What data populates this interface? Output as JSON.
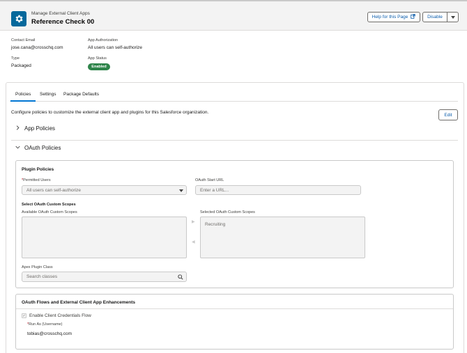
{
  "header": {
    "breadcrumb": "Manage External Client Apps",
    "title": "Reference Check 00",
    "help_label": "Help for this Page",
    "disable_label": "Disable"
  },
  "details": {
    "contact_email_label": "Contact Email",
    "contact_email_value": "jose.cana@crosschq.com",
    "app_authorization_label": "App Authorization",
    "app_authorization_value": "All users can self-authorize",
    "type_label": "Type",
    "type_value": "Packaged",
    "app_status_label": "App Status",
    "app_status_value": "Enabled"
  },
  "tabs": [
    {
      "label": "Policies",
      "active": true
    },
    {
      "label": "Settings",
      "active": false
    },
    {
      "label": "Package Defaults",
      "active": false
    }
  ],
  "policies": {
    "description": "Configure policies to customize the external client app and plugins for this Salesforce organization.",
    "edit_label": "Edit",
    "app_policies_label": "App Policies",
    "oauth_policies_label": "OAuth Policies"
  },
  "plugin_policies": {
    "title": "Plugin Policies",
    "permitted_users_label": "Permitted Users",
    "permitted_users_value": "All users can self-authorize",
    "oauth_start_url_label": "OAuth Start URL",
    "oauth_start_url_placeholder": "Enter a URL...",
    "scopes_title": "Select OAuth Custom Scopes",
    "available_scopes_label": "Available OAuth Custom Scopes",
    "selected_scopes_label": "Selected OAuth Custom Scopes",
    "selected_scopes": [
      "Recruiting"
    ],
    "apex_plugin_label": "Apex Plugin Class",
    "apex_plugin_placeholder": "Search classes"
  },
  "oauth_flows": {
    "title": "OAuth Flows and External Client App Enhancements",
    "client_credentials_label": "Enable Client Credentials Flow",
    "client_credentials_checked": true,
    "run_as_label": "Run As (Username)",
    "run_as_value": "tobias@crosschq.com"
  },
  "icons": {
    "app": "gear-icon",
    "help": "new-window-icon",
    "menu": "chevron-down-icon",
    "search": "search-icon"
  },
  "colors": {
    "brand": "#04689b",
    "accent": "#0176d3",
    "success": "#2e844a"
  }
}
